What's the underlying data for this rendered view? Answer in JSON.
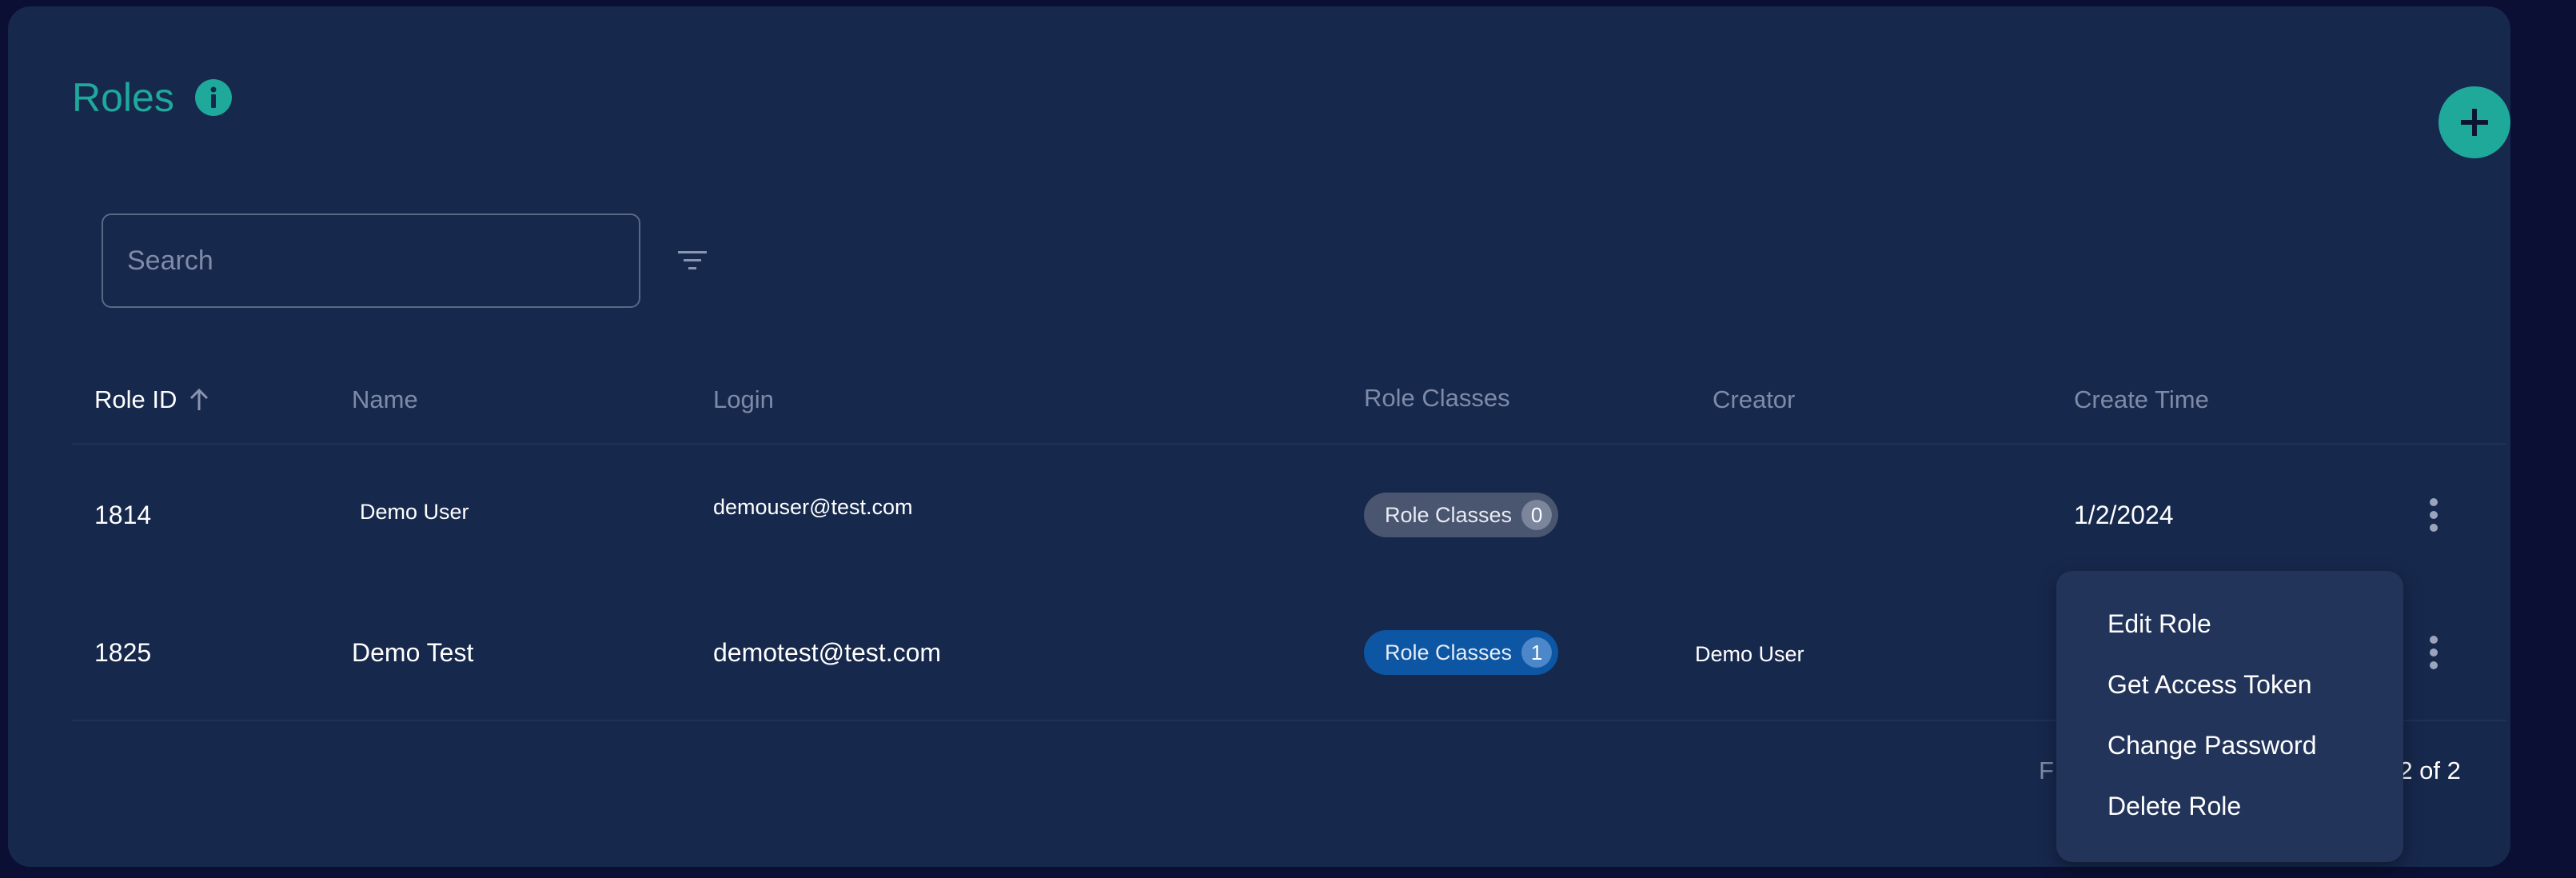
{
  "header": {
    "title": "Roles"
  },
  "search": {
    "placeholder": "Search",
    "value": ""
  },
  "table": {
    "columns": {
      "role_id": "Role ID",
      "name": "Name",
      "login": "Login",
      "role_classes": "Role Classes",
      "creator": "Creator",
      "create_time": "Create Time"
    },
    "rows": [
      {
        "role_id": "1814",
        "name": "Demo User",
        "login": "demouser@test.com",
        "role_classes_label": "Role Classes",
        "role_classes_count": "0",
        "creator": "",
        "create_time": "1/2/2024"
      },
      {
        "role_id": "1825",
        "name": "Demo Test",
        "login": "demotest@test.com",
        "role_classes_label": "Role Classes",
        "role_classes_count": "1",
        "creator": "Demo User",
        "create_time": ""
      }
    ]
  },
  "pagination": {
    "left_fragment": "F",
    "range_text": "-2 of 2"
  },
  "context_menu": {
    "items": [
      "Edit Role",
      "Get Access Token",
      "Change Password",
      "Delete Role"
    ]
  },
  "colors": {
    "background": "#0b0f33",
    "panel": "#17284d",
    "accent": "#1ea99b",
    "chip_inactive": "#4a5570",
    "chip_active": "#0d56a3",
    "menu": "#22345a"
  },
  "icons": {
    "info": "info-icon",
    "add": "plus-icon",
    "filter": "filter-icon",
    "sort": "arrow-up-icon",
    "row_actions": "more-vertical-icon"
  }
}
